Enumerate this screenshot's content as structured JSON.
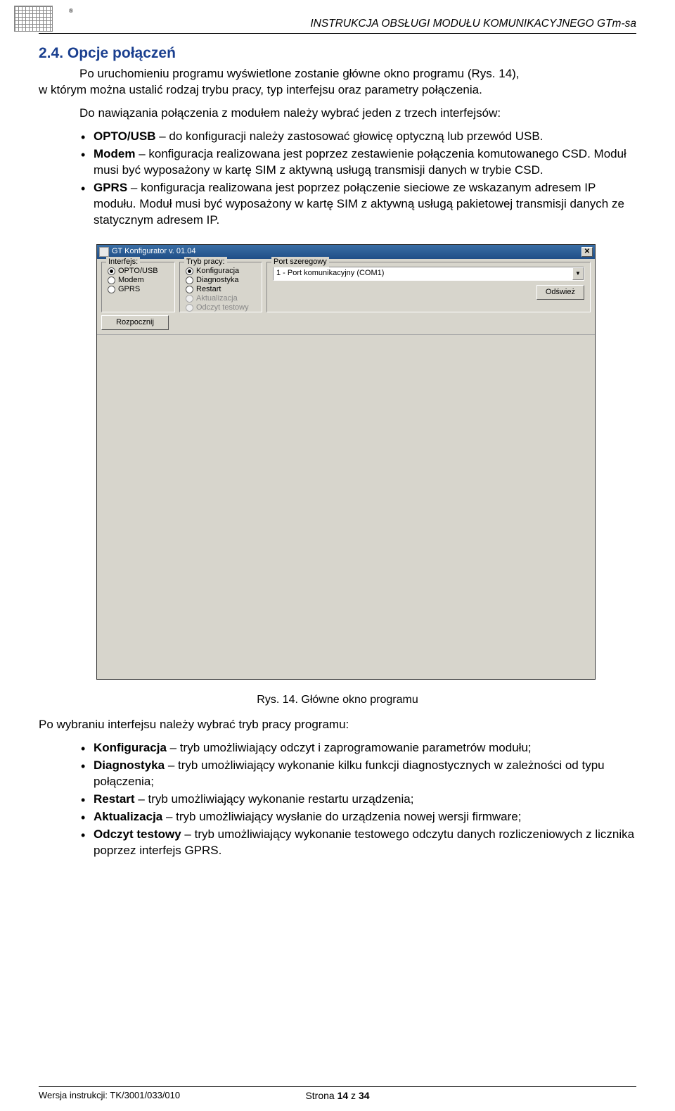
{
  "header": {
    "title": "INSTRUKCJA OBSŁUGI MODUŁU KOMUNIKACYJNEGO GTm-sa",
    "reg": "®"
  },
  "section": {
    "number_title": "2.4. Opcje połączeń",
    "p1a": "Po uruchomieniu programu wyświetlone zostanie główne okno programu (Rys. 14),",
    "p1b": "w którym można ustalić rodzaj trybu pracy, typ interfejsu oraz parametry połączenia.",
    "p2": "Do nawiązania połączenia z modułem należy wybrać jeden z trzech interfejsów:",
    "bullets1": [
      {
        "b": "OPTO/USB",
        "t": " – do konfiguracji należy zastosować głowicę optyczną lub przewód USB."
      },
      {
        "b": "Modem",
        "t": " – konfiguracja realizowana jest poprzez zestawienie połączenia komutowanego CSD. Moduł musi być wyposażony w kartę SIM z aktywną usługą transmisji danych w trybie CSD."
      },
      {
        "b": "GPRS",
        "t": " – konfiguracja realizowana jest poprzez połączenie sieciowe ze wskazanym adresem IP modułu. Moduł musi być wyposażony w kartę SIM z aktywną usługą pakietowej transmisji danych ze statycznym adresem IP."
      }
    ],
    "fig_caption": "Rys. 14. Główne okno programu",
    "p3": "Po wybraniu interfejsu należy wybrać tryb pracy programu:",
    "bullets2": [
      {
        "b": "Konfiguracja",
        "t": " – tryb umożliwiający odczyt i zaprogramowanie parametrów modułu;"
      },
      {
        "b": "Diagnostyka",
        "t": " – tryb umożliwiający wykonanie kilku funkcji diagnostycznych w zależności od typu połączenia;"
      },
      {
        "b": "Restart",
        "t": " – tryb umożliwiający wykonanie restartu urządzenia;"
      },
      {
        "b": "Aktualizacja",
        "t": " – tryb umożliwiający wysłanie do urządzenia nowej wersji firmware;"
      },
      {
        "b": "Odczyt testowy",
        "t": " – tryb umożliwiający wykonanie testowego odczytu danych rozliczeniowych z licznika poprzez interfejs GPRS."
      }
    ]
  },
  "app": {
    "title": "GT Konfigurator v. 01.04",
    "close": "✕",
    "groups": {
      "interfejs": {
        "legend": "Interfejs:",
        "opts": [
          "OPTO/USB",
          "Modem",
          "GPRS"
        ]
      },
      "tryb": {
        "legend": "Tryb pracy:",
        "opts": [
          "Konfiguracja",
          "Diagnostyka",
          "Restart",
          "Aktualizacja",
          "Odczyt testowy"
        ]
      },
      "port": {
        "legend": "Port szeregowy",
        "combo": "1 - Port komunikacyjny (COM1)",
        "arrow": "▼",
        "refresh": "Odśwież"
      }
    },
    "start_btn": "Rozpocznij"
  },
  "footer": {
    "left": "Wersja instrukcji: TK/3001/033/010",
    "center_a": "Strona ",
    "center_b": "14",
    "center_c": " z ",
    "center_d": "34"
  }
}
